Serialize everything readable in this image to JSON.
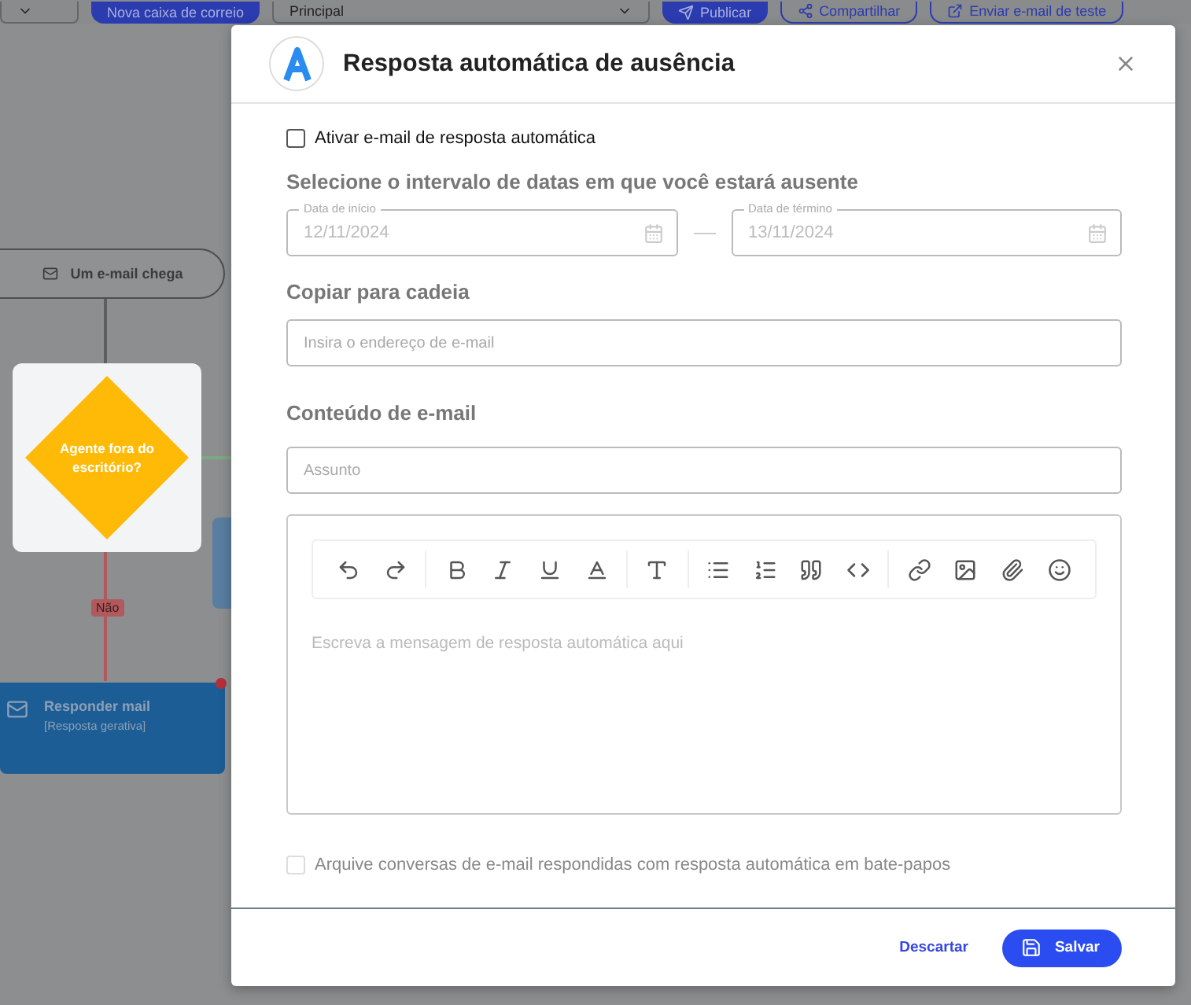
{
  "toolbar": {
    "items": [
      {
        "kind": "select"
      },
      {
        "kind": "primary",
        "label": "Nova caixa de correio"
      },
      {
        "kind": "select",
        "label": "Principal"
      },
      {
        "kind": "primary",
        "label": "Publicar"
      },
      {
        "kind": "outline",
        "label": "Compartilhar"
      },
      {
        "kind": "outline",
        "label": "Enviar e-mail de teste"
      }
    ]
  },
  "flow": {
    "trigger": "Um e-mail chega",
    "condition": "Agente fora do escritório?",
    "branch_label": "Não",
    "action": {
      "title": "Responder mail",
      "subtitle": "[Resposta gerativa]"
    }
  },
  "dialog": {
    "title": "Resposta automática de ausência",
    "enable": {
      "label": "Ativar e-mail de resposta automática",
      "checked": false
    },
    "date_heading": "Selecione o intervalo de datas em que você estará ausente",
    "dates": [
      {
        "label": "Data de início",
        "value": "12/11/2024"
      },
      {
        "label": "Data de término",
        "value": "13/11/2024"
      }
    ],
    "copy_heading": "Copiar para cadeia",
    "copy_field": {
      "placeholder": "Insira o endereço de e-mail"
    },
    "content_heading": "Conteúdo de e-mail",
    "subject_field": {
      "placeholder": "Assunto"
    },
    "editor": {
      "placeholder": "Escreva a mensagem de resposta automática aqui"
    },
    "archive": {
      "label": "Arquive conversas de e-mail respondidas com resposta automática em bate-papos",
      "checked": false,
      "disabled": true
    },
    "buttons": [
      {
        "kind": "text",
        "label": "Descartar"
      },
      {
        "kind": "primary",
        "label": "Salvar"
      }
    ]
  }
}
